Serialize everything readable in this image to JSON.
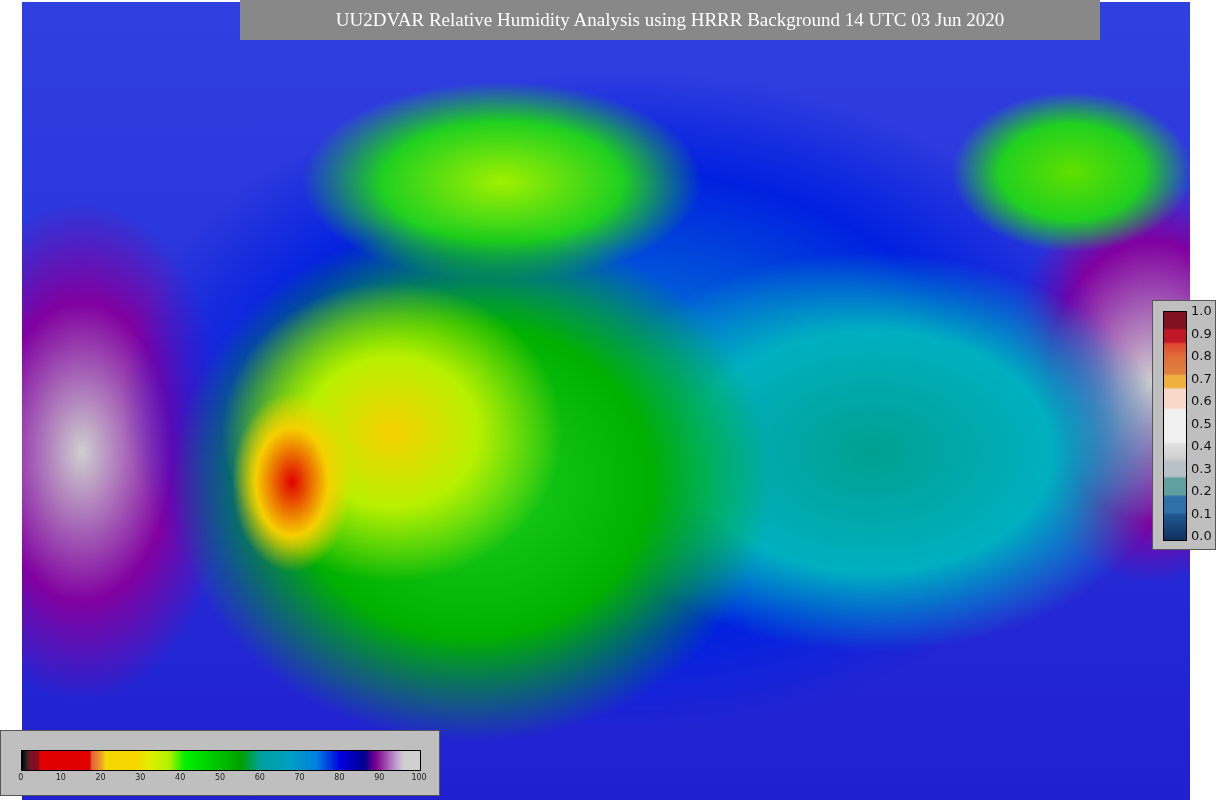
{
  "title": "UU2DVAR Relative Humidity Analysis using HRRR Background 14 UTC 03 Jun 2020",
  "humidity_colorbar": {
    "ticks": [
      "0",
      "10",
      "20",
      "30",
      "40",
      "50",
      "60",
      "70",
      "80",
      "90",
      "100"
    ]
  },
  "error_colorbar": {
    "ticks": [
      "1.0",
      "0.9",
      "0.8",
      "0.7",
      "0.6",
      "0.5",
      "0.4",
      "0.3",
      "0.2",
      "0.1",
      "0.0"
    ]
  }
}
